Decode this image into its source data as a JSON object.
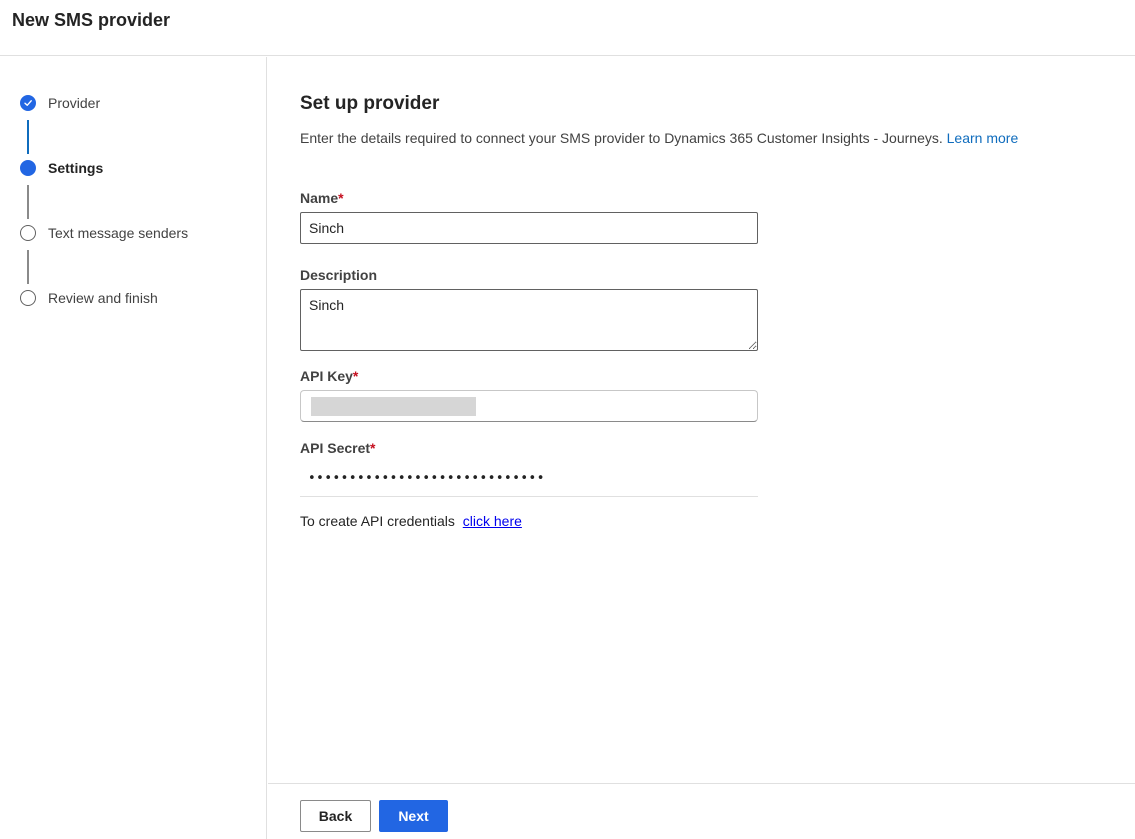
{
  "header": {
    "title": "New SMS provider"
  },
  "steps": [
    {
      "label": "Provider",
      "state": "done"
    },
    {
      "label": "Settings",
      "state": "current"
    },
    {
      "label": "Text message senders",
      "state": "pending"
    },
    {
      "label": "Review and finish",
      "state": "pending"
    }
  ],
  "main": {
    "title": "Set up provider",
    "description": "Enter the details required to connect your SMS provider to Dynamics 365 Customer Insights - Journeys.",
    "learn_more": "Learn more",
    "required_marker": "*",
    "fields": {
      "name": {
        "label": "Name",
        "value": "Sinch"
      },
      "description": {
        "label": "Description",
        "value": "Sinch"
      },
      "api_key": {
        "label": "API Key",
        "value": ""
      },
      "api_secret": {
        "label": "API Secret",
        "value": "•••••••••••••••••••••••••••••"
      }
    },
    "credentials_text": "To create API credentials",
    "credentials_link": "click here"
  },
  "footer": {
    "back_label": "Back",
    "next_label": "Next"
  },
  "colors": {
    "accent": "#2266e3",
    "link": "#0f6cbd",
    "required": "#c50f1f"
  }
}
